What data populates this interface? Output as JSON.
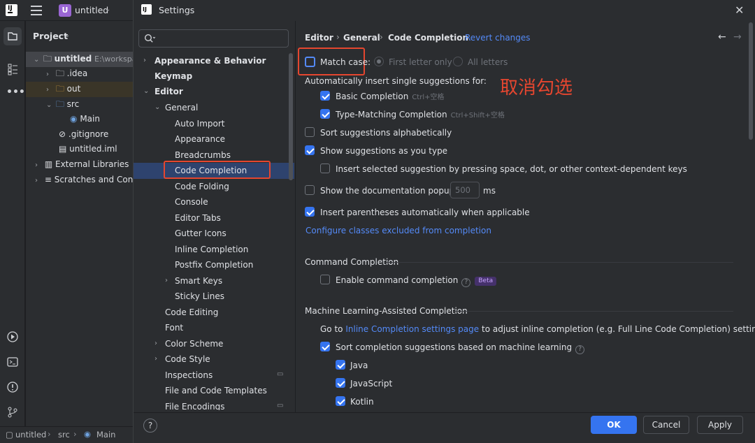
{
  "ide": {
    "project_name": "untitled",
    "project_widget_label": "Project",
    "tree": [
      {
        "label": "untitled",
        "suffix": "E:\\workspa"
      },
      {
        "label": ".idea"
      },
      {
        "label": "out"
      },
      {
        "label": "src"
      },
      {
        "label": "Main"
      },
      {
        "label": ".gitignore"
      },
      {
        "label": "untitled.iml"
      },
      {
        "label": "External Libraries"
      },
      {
        "label": "Scratches and Conso"
      }
    ],
    "status": {
      "project": "untitled",
      "src": "src",
      "main": "Main"
    }
  },
  "dialog": {
    "title": "Settings",
    "search_placeholder": "",
    "nav": [
      {
        "label": "Appearance & Behavior"
      },
      {
        "label": "Keymap"
      },
      {
        "label": "Editor"
      },
      {
        "label": "General"
      },
      {
        "label": "Auto Import"
      },
      {
        "label": "Appearance"
      },
      {
        "label": "Breadcrumbs"
      },
      {
        "label": "Code Completion"
      },
      {
        "label": "Code Folding"
      },
      {
        "label": "Console"
      },
      {
        "label": "Editor Tabs"
      },
      {
        "label": "Gutter Icons"
      },
      {
        "label": "Inline Completion"
      },
      {
        "label": "Postfix Completion"
      },
      {
        "label": "Smart Keys"
      },
      {
        "label": "Sticky Lines"
      },
      {
        "label": "Code Editing"
      },
      {
        "label": "Font"
      },
      {
        "label": "Color Scheme"
      },
      {
        "label": "Code Style"
      },
      {
        "label": "Inspections"
      },
      {
        "label": "File and Code Templates"
      },
      {
        "label": "File Encodings"
      }
    ],
    "breadcrumb": {
      "editor": "Editor",
      "general": "General",
      "current": "Code Completion",
      "revert": "Revert changes"
    },
    "annotation": "取消勾选",
    "options": {
      "match_case": {
        "label": "Match case:",
        "checked": false
      },
      "first_letter": "First letter only",
      "all_letters": "All letters",
      "auto_insert_heading": "Automatically insert single suggestions for:",
      "basic": {
        "label": "Basic Completion",
        "shortcut": "Ctrl+空格",
        "checked": true
      },
      "type_matching": {
        "label": "Type-Matching Completion",
        "shortcut": "Ctrl+Shift+空格",
        "checked": true
      },
      "sort_alpha": {
        "label": "Sort suggestions alphabetically",
        "checked": false
      },
      "show_as_type": {
        "label": "Show suggestions as you type",
        "checked": true
      },
      "insert_selected": {
        "label": "Insert selected suggestion by pressing space, dot, or other context-dependent keys",
        "checked": false
      },
      "show_doc": {
        "label": "Show the documentation popup in",
        "value": "500",
        "unit": "ms",
        "checked": false
      },
      "insert_paren": {
        "label": "Insert parentheses automatically when applicable",
        "checked": true
      },
      "configure_link": "Configure classes excluded from completion",
      "command_heading": "Command Completion",
      "enable_command": {
        "label": "Enable command completion",
        "badge": "Beta",
        "checked": false
      },
      "ml_heading": "Machine Learning-Assisted Completion",
      "goto_prefix": "Go to",
      "goto_link": "Inline Completion settings page",
      "goto_suffix": "to adjust inline completion (e.g. Full Line Code Completion) settings",
      "sort_ml": {
        "label": "Sort completion suggestions based on machine learning",
        "checked": true
      },
      "java": {
        "label": "Java",
        "checked": true
      },
      "javascript": {
        "label": "JavaScript",
        "checked": true
      },
      "kotlin": {
        "label": "Kotlin",
        "checked": true
      }
    },
    "buttons": {
      "ok": "OK",
      "cancel": "Cancel",
      "apply": "Apply",
      "help": "?"
    }
  }
}
